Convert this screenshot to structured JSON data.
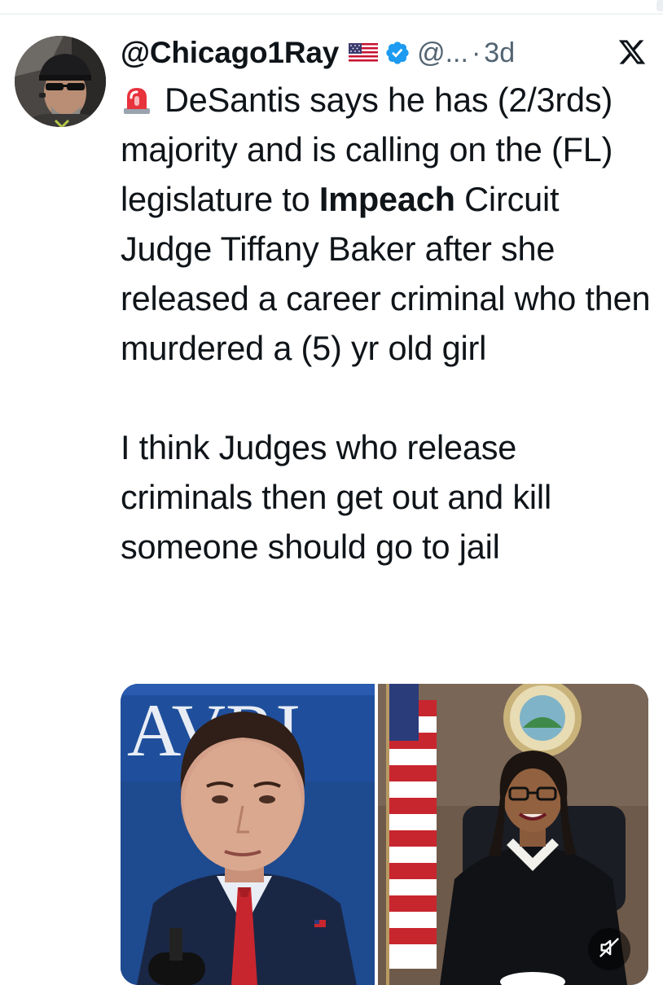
{
  "tweet": {
    "author": {
      "handle": "@Chicago1Ray",
      "username": "@...",
      "separator": "·",
      "time_ago": "3d",
      "flag": "us-flag-icon",
      "badge": "verified-badge-icon"
    },
    "siren_emoji": "rotating-light-icon",
    "text": {
      "p1_before_bold": "DeSantis says he has (2/3rds) majority and is calling on the (FL) legislature to ",
      "p1_bold": "Impeach",
      "p1_after_bold": " Circuit Judge Tiffany Baker after she released a career criminal who then murdered a (5) yr old girl",
      "p2": "I think Judges who release criminals then get out and kill someone should go to jail"
    },
    "media": {
      "left_panel_sign_text": "AVRI",
      "video_muted": true
    }
  },
  "icons": {
    "platform_logo": "x-logo-icon",
    "mute": "speaker-muted-icon"
  },
  "colors": {
    "text": "#0f1419",
    "muted": "#536471",
    "verified_blue": "#1d9bf0",
    "divider": "#eff3f4"
  }
}
